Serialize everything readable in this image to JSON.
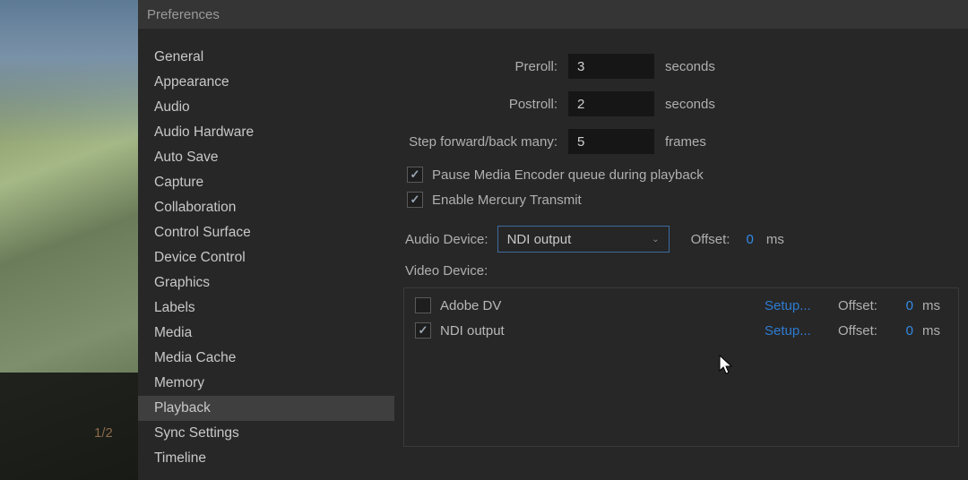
{
  "window_title": "Preferences",
  "page_indicator": "1/2",
  "sidebar": {
    "selected_index": 14,
    "items": [
      {
        "label": "General"
      },
      {
        "label": "Appearance"
      },
      {
        "label": "Audio"
      },
      {
        "label": "Audio Hardware"
      },
      {
        "label": "Auto Save"
      },
      {
        "label": "Capture"
      },
      {
        "label": "Collaboration"
      },
      {
        "label": "Control Surface"
      },
      {
        "label": "Device Control"
      },
      {
        "label": "Graphics"
      },
      {
        "label": "Labels"
      },
      {
        "label": "Media"
      },
      {
        "label": "Media Cache"
      },
      {
        "label": "Memory"
      },
      {
        "label": "Playback"
      },
      {
        "label": "Sync Settings"
      },
      {
        "label": "Timeline"
      }
    ]
  },
  "playback": {
    "preroll_label": "Preroll:",
    "preroll_value": "3",
    "preroll_unit": "seconds",
    "postroll_label": "Postroll:",
    "postroll_value": "2",
    "postroll_unit": "seconds",
    "step_label": "Step forward/back many:",
    "step_value": "5",
    "step_unit": "frames",
    "pause_checked": true,
    "pause_label": "Pause Media Encoder queue during playback",
    "mercury_checked": true,
    "mercury_label": "Enable Mercury Transmit",
    "audio_device_label": "Audio Device:",
    "audio_device_value": "NDI output",
    "audio_offset_label": "Offset:",
    "audio_offset_value": "0",
    "audio_offset_unit": "ms",
    "video_device_label": "Video Device:",
    "devices": [
      {
        "name": "Adobe DV",
        "checked": false,
        "setup": "Setup...",
        "offset_label": "Offset:",
        "offset_value": "0",
        "offset_unit": "ms"
      },
      {
        "name": "NDI output",
        "checked": true,
        "setup": "Setup...",
        "offset_label": "Offset:",
        "offset_value": "0",
        "offset_unit": "ms"
      }
    ]
  }
}
